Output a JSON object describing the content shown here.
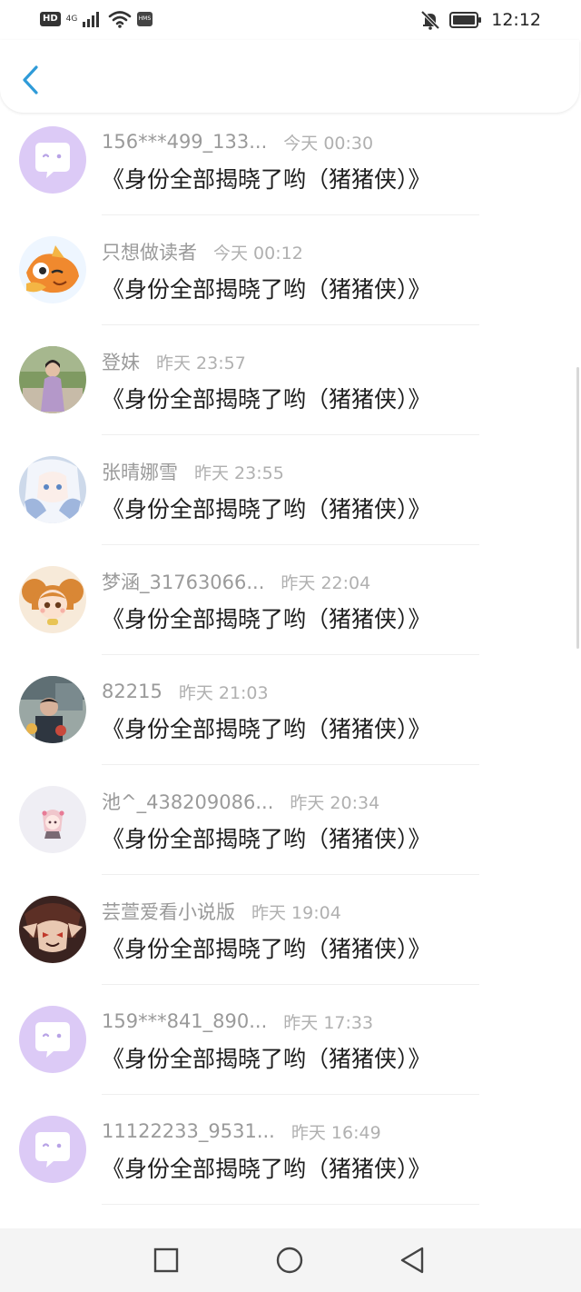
{
  "status_bar": {
    "hd": "HD",
    "network": "4G",
    "hms": "HMS",
    "time": "12:12"
  },
  "icons": {
    "back": "back-arrow-icon",
    "signal": "signal-icon",
    "wifi": "wifi-icon",
    "mute": "bell-off-icon",
    "battery": "battery-icon",
    "default_avatar": "chat-bubble-icon",
    "recent_apps": "square-icon",
    "home": "circle-icon",
    "back_nav": "triangle-back-icon"
  },
  "colors": {
    "back_arrow": "#2f9bd8",
    "default_avatar_bg": "#dccaf6",
    "name_text": "#9a9a9a",
    "time_text": "#b0b0b0",
    "message_text": "#1e1e1e"
  },
  "comments": [
    {
      "user": "156***499_133...",
      "time": "今天 00:30",
      "message": "《身份全部揭晓了哟（猪猪侠）》",
      "avatar": "default"
    },
    {
      "user": "只想做读者",
      "time": "今天 00:12",
      "message": "《身份全部揭晓了哟（猪猪侠）》",
      "avatar": "fish"
    },
    {
      "user": "登妹",
      "time": "昨天 23:57",
      "message": "《身份全部揭晓了哟（猪猪侠）》",
      "avatar": "photo-girl"
    },
    {
      "user": "张晴娜雪",
      "time": "昨天 23:55",
      "message": "《身份全部揭晓了哟（猪猪侠）》",
      "avatar": "anime-white"
    },
    {
      "user": "梦涵_31763066...",
      "time": "昨天 22:04",
      "message": "《身份全部揭晓了哟（猪猪侠）》",
      "avatar": "cartoon-girl"
    },
    {
      "user": "82215",
      "time": "昨天 21:03",
      "message": "《身份全部揭晓了哟（猪猪侠）》",
      "avatar": "photo-kid"
    },
    {
      "user": "池^_438209086...",
      "time": "昨天 20:34",
      "message": "《身份全部揭晓了哟（猪猪侠）》",
      "avatar": "chibi-pink"
    },
    {
      "user": "芸萱爱看小说版",
      "time": "昨天 19:04",
      "message": "《身份全部揭晓了哟（猪猪侠）》",
      "avatar": "anime-dark"
    },
    {
      "user": "159***841_890...",
      "time": "昨天 17:33",
      "message": "《身份全部揭晓了哟（猪猪侠）》",
      "avatar": "default"
    },
    {
      "user": "11122233_9531...",
      "time": "昨天 16:49",
      "message": "《身份全部揭晓了哟（猪猪侠）》",
      "avatar": "default"
    }
  ]
}
